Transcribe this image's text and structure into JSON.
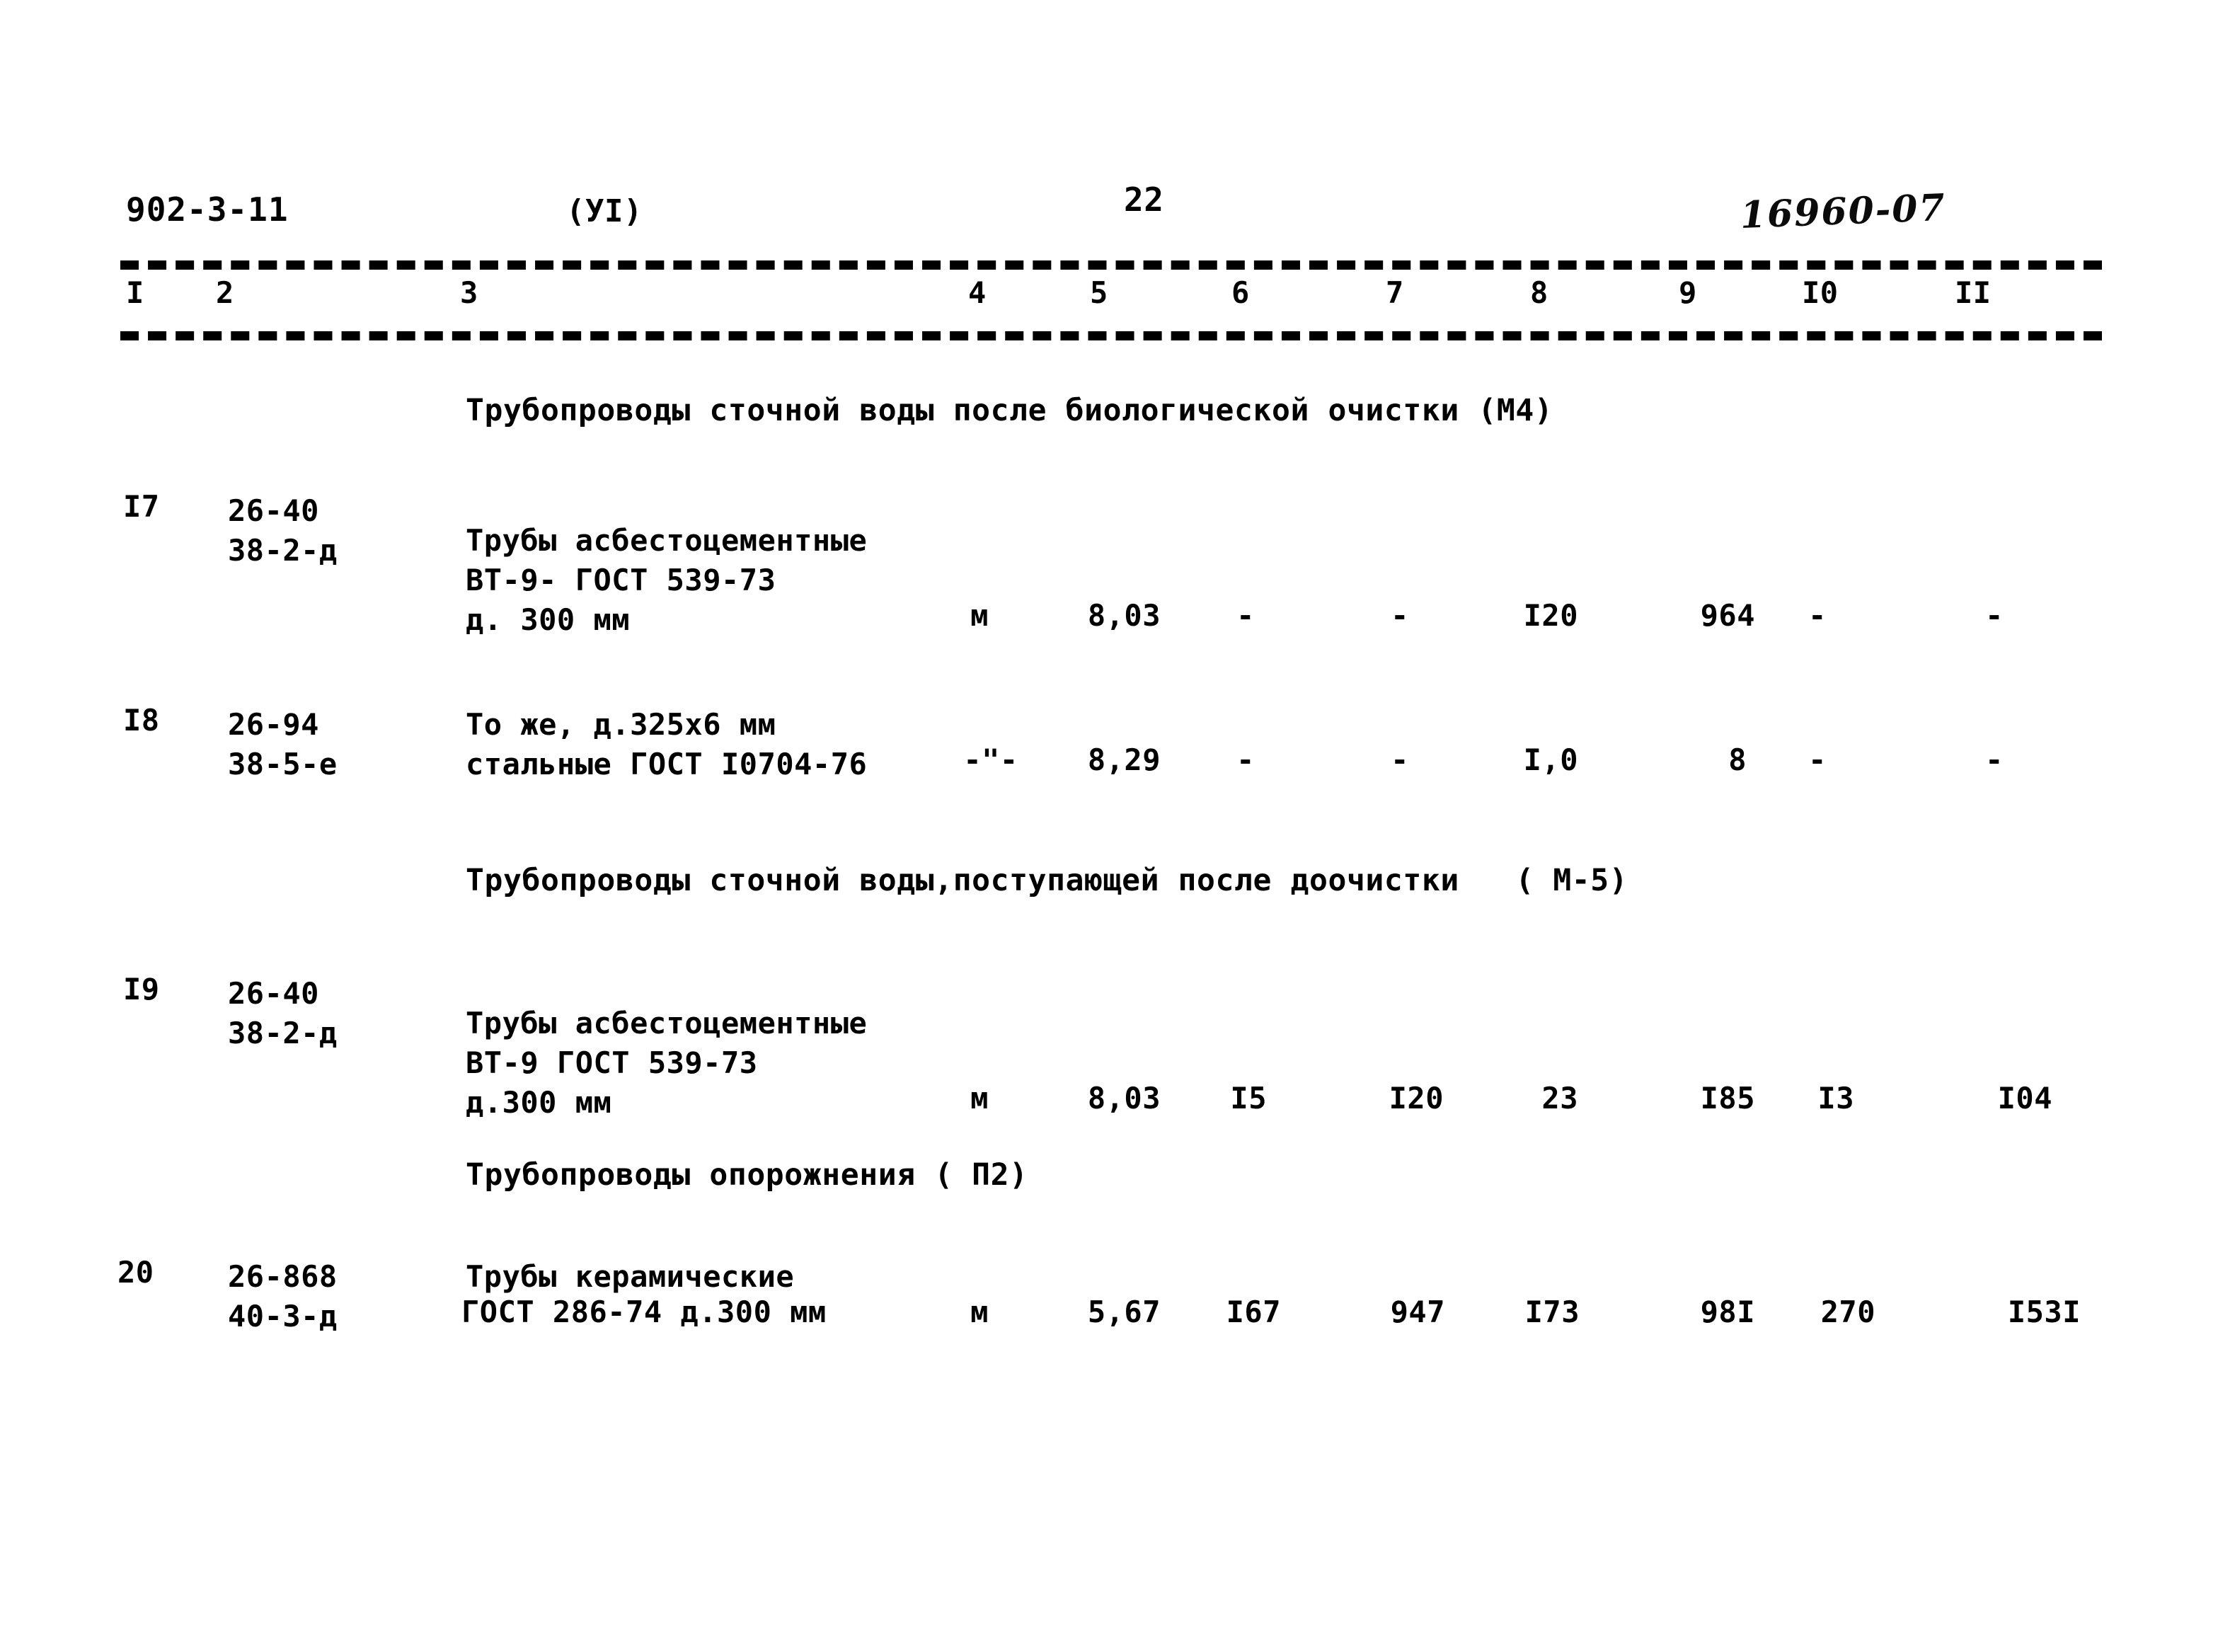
{
  "header": {
    "doc_code": "902-3-11",
    "part_code": "(УI)",
    "page_number": "22",
    "archive_stamp": "16960-07"
  },
  "column_numbers": [
    "I",
    "2",
    "3",
    "4",
    "5",
    "6",
    "7",
    "8",
    "9",
    "I0",
    "II"
  ],
  "sections": [
    {
      "heading": "Трубопроводы сточной воды после биологической очистки (М4)",
      "rows": [
        {
          "num": "I7",
          "codes": [
            "26-40",
            "38-2-д"
          ],
          "description": [
            "Трубы асбестоцементные",
            "ВТ-9- ГОСТ 539-73",
            "д. 300 мм"
          ],
          "unit": "м",
          "values": [
            "8,03",
            "-",
            "-",
            "I20",
            "964",
            "-",
            "-"
          ]
        },
        {
          "num": "I8",
          "codes": [
            "26-94",
            "38-5-е"
          ],
          "description": [
            "То же, д.325х6 мм",
            "стальные ГОСТ I0704-76"
          ],
          "unit": "-\"-",
          "values": [
            "8,29",
            "-",
            "-",
            "I,0",
            "8",
            "-",
            "-"
          ]
        }
      ]
    },
    {
      "heading": "Трубопроводы сточной воды,поступающей после доочистки   ( М-5)",
      "rows": [
        {
          "num": "I9",
          "codes": [
            "26-40",
            "38-2-д"
          ],
          "description": [
            "Трубы асбестоцементные",
            "ВТ-9 ГОСТ 539-73",
            "д.300 мм"
          ],
          "unit": "м",
          "values": [
            "8,03",
            "I5",
            "I20",
            "23",
            "I85",
            "I3",
            "I04"
          ]
        }
      ]
    },
    {
      "heading": "Трубопроводы опорожнения ( П2)",
      "rows": [
        {
          "num": "20",
          "codes": [
            "26-868",
            "40-3-д"
          ],
          "description": [
            "Трубы керамические",
            "ГОСТ 286-74 д.300 мм"
          ],
          "unit": "м",
          "values": [
            "5,67",
            "I67",
            "947",
            "I73",
            "98I",
            "270",
            "I53I"
          ]
        }
      ]
    }
  ]
}
